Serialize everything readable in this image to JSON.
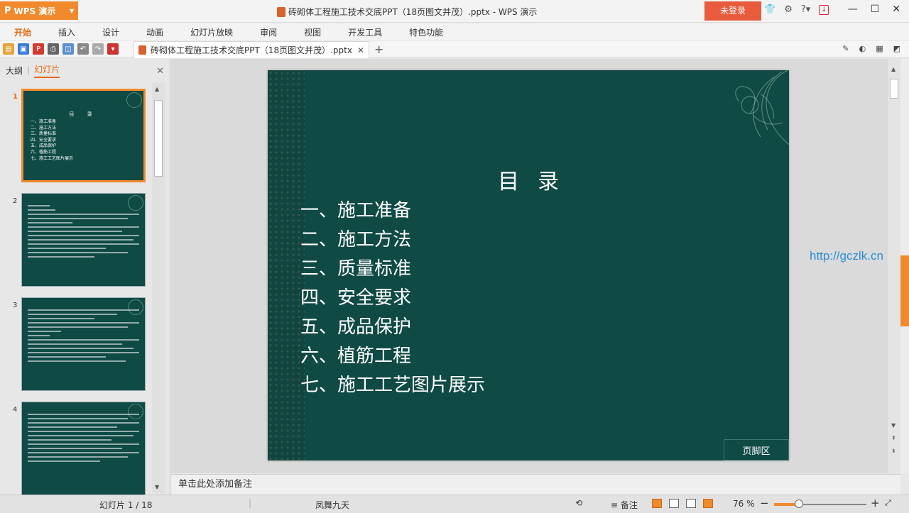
{
  "app": {
    "button_label": "WPS 演示",
    "logo_glyph": "P",
    "window_title": "砖砌体工程施工技术交底PPT（18页图文并茂）.pptx - WPS 演示",
    "login_label": "未登录",
    "accent_color": "#f08a2c"
  },
  "menu": [
    "开始",
    "插入",
    "设计",
    "动画",
    "幻灯片放映",
    "审阅",
    "视图",
    "开发工具",
    "特色功能"
  ],
  "doc_tab": {
    "label": "砖砌体工程施工技术交底PPT（18页图文并茂）.pptx",
    "close": "✕",
    "new_tab": "+"
  },
  "left_pane": {
    "tab_outline": "大纲",
    "tab_separator": "|",
    "tab_slides": "幻灯片",
    "close": "✕",
    "thumbnails": [
      {
        "number": "1",
        "title": "目 录",
        "items": [
          "一、施工准备",
          "二、施工方法",
          "三、质量标准",
          "四、安全要求",
          "五、成品保护",
          "六、植筋工程",
          "七、施工工艺图片展示"
        ]
      },
      {
        "number": "2"
      },
      {
        "number": "3"
      },
      {
        "number": "4"
      }
    ]
  },
  "slide": {
    "title": "目录",
    "items": [
      "一、施工准备",
      "二、施工方法",
      "三、质量标准",
      "四、安全要求",
      "五、成品保护",
      "六、植筋工程",
      "七、施工工艺图片展示"
    ],
    "footer": "页脚区",
    "background_color": "#0f4a45"
  },
  "watermark": "http://gczlk.cn",
  "notes_placeholder": "单击此处添加备注",
  "status": {
    "slide_counter": "幻灯片 1 / 18",
    "theme": "凤舞九天",
    "notes_label": "备注",
    "zoom": "76 %",
    "zoom_percent": 76
  }
}
